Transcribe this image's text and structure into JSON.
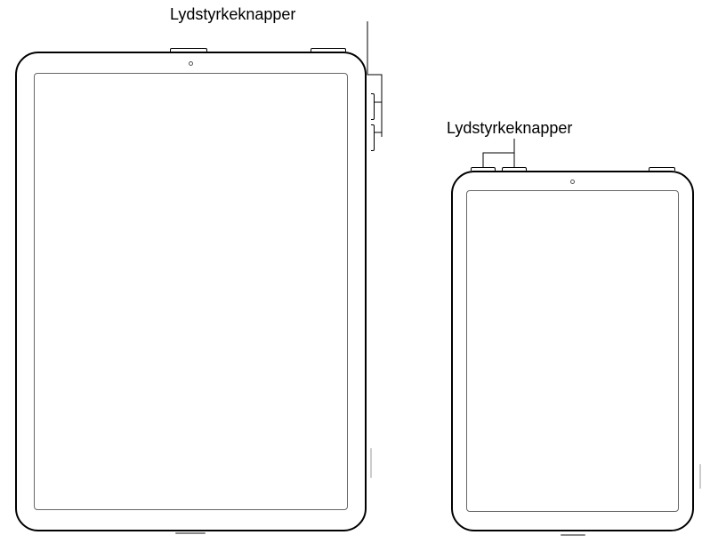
{
  "labels": {
    "large_volume": "Lydstyrkeknapper",
    "small_volume": "Lydstyrkeknapper"
  },
  "devices": {
    "large": {
      "name": "ipad-large",
      "volume_buttons_location": "right-side",
      "top_buttons": 2,
      "side_volume_buttons": 2
    },
    "small": {
      "name": "ipad-small",
      "volume_buttons_location": "top-edge",
      "top_volume_buttons": 2,
      "top_power_button": 1
    }
  }
}
